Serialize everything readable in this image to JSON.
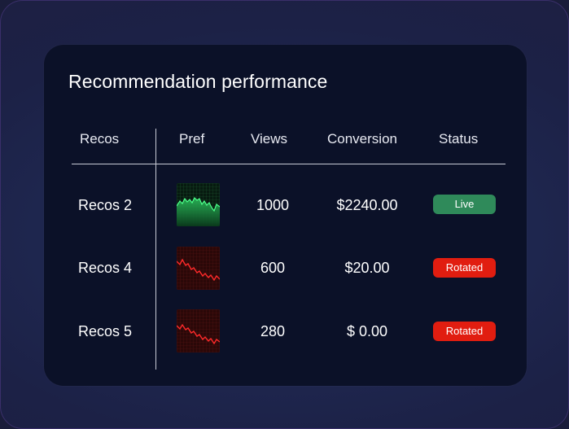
{
  "card": {
    "title": "Recommendation performance"
  },
  "table": {
    "headers": {
      "recos": "Recos",
      "pref": "Pref",
      "views": "Views",
      "conversion": "Conversion",
      "status": "Status"
    },
    "rows": [
      {
        "recos": "Recos 2",
        "trend": "up",
        "views": "1000",
        "conversion": "$2240.00",
        "status": "Live"
      },
      {
        "recos": "Recos 4",
        "trend": "down",
        "views": "600",
        "conversion": "$20.00",
        "status": "Rotated"
      },
      {
        "recos": "Recos 5",
        "trend": "down",
        "views": "280",
        "conversion": "$ 0.00",
        "status": "Rotated"
      }
    ]
  },
  "colors": {
    "card_bg": "#0b1128",
    "live_badge": "#2f8a5a",
    "rotated_badge": "#e11d10",
    "trend_up": "#3fe07a",
    "trend_down": "#ff2a2a"
  },
  "icons": {
    "trend_up": "sparkline-up-icon",
    "trend_down": "sparkline-down-icon"
  }
}
